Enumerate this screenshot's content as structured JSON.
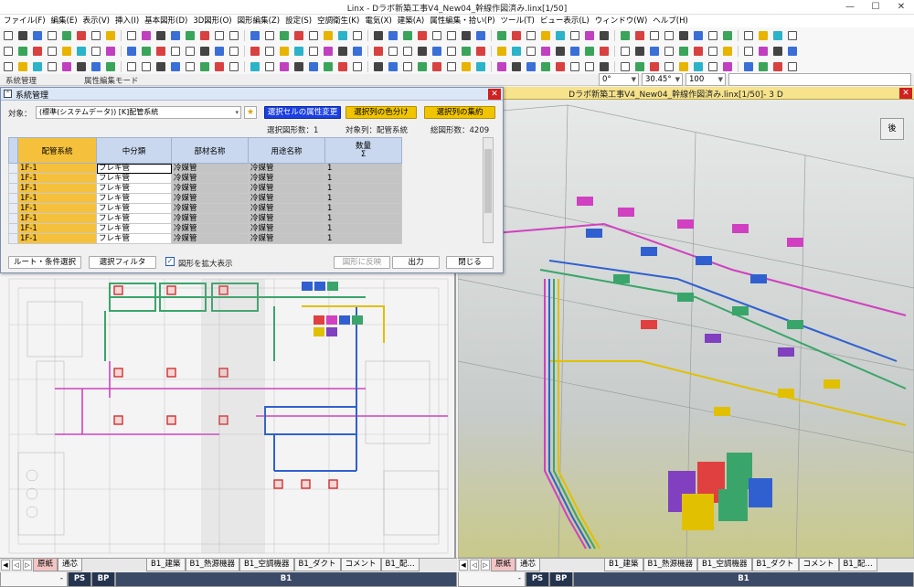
{
  "window": {
    "title": "Linx - Dラボ新築工事V4_New04_幹線作図済み.linx[1/50]",
    "minimize": "—",
    "maximize": "☐",
    "close": "✕"
  },
  "menu": [
    "ファイル(F)",
    "編集(E)",
    "表示(V)",
    "挿入(I)",
    "基本図形(D)",
    "3D図形(O)",
    "図形編集(Z)",
    "設定(S)",
    "空調衛生(K)",
    "電気(X)",
    "建築(A)",
    "属性編集・拾い(P)",
    "ツール(T)",
    "ビュー表示(L)",
    "ウィンドウ(W)",
    "ヘルプ(H)"
  ],
  "status_row": {
    "left_label": "系統管理",
    "right_label": "属性編集モード",
    "angle": "0°",
    "angle2": "30.45°",
    "zoom": "100"
  },
  "dialog": {
    "title": "系統管理",
    "target_label": "対象：",
    "target_value": "(標準(システムデータ)) [K]配管系統",
    "btn_change_attr": "選択セルの属性変更",
    "btn_color_split": "選択列の色分け",
    "btn_aggregate": "選択列の集約",
    "info_selected_shapes": "選択図形数：1",
    "info_target_col": "対象列：配管系統",
    "info_total_shapes": "総図形数：4209",
    "columns": [
      "配管系統",
      "中分類",
      "部材名称",
      "用途名称",
      "数量\nΣ"
    ],
    "rows": [
      [
        "1F-1",
        "フレキ管",
        "冷媒管",
        "冷媒管",
        "1"
      ],
      [
        "1F-1",
        "フレキ管",
        "冷媒管",
        "冷媒管",
        "1"
      ],
      [
        "1F-1",
        "フレキ管",
        "冷媒管",
        "冷媒管",
        "1"
      ],
      [
        "1F-1",
        "フレキ管",
        "冷媒管",
        "冷媒管",
        "1"
      ],
      [
        "1F-1",
        "フレキ管",
        "冷媒管",
        "冷媒管",
        "1"
      ],
      [
        "1F-1",
        "フレキ管",
        "冷媒管",
        "冷媒管",
        "1"
      ],
      [
        "1F-1",
        "フレキ管",
        "冷媒管",
        "冷媒管",
        "1"
      ],
      [
        "1F-1",
        "フレキ管",
        "冷媒管",
        "冷媒管",
        "1"
      ]
    ],
    "btn_route": "ルート・条件選択",
    "btn_filter": "選択フィルタ",
    "chk_enlarge": "図形を拡大表示",
    "btn_reflect": "図形に反映",
    "btn_output": "出力",
    "btn_close": "閉じる"
  },
  "view3d": {
    "title": "Dラボ新築工事V4_New04_幹線作図済み.linx[1/50]- 3 D",
    "cube_label": "後"
  },
  "bottom_left": {
    "tabs_top": [
      "原紙",
      "通芯",
      "B1_建築",
      "B1_熱源機器",
      "B1_空調機器",
      "B1_ダクト",
      "コメント",
      "B1_配..."
    ],
    "tabs_bottom": [
      "-",
      "PS",
      "BP",
      "B1"
    ]
  },
  "bottom_right": {
    "tabs_top": [
      "原紙",
      "通芯",
      "B1_建築",
      "B1_熱源機器",
      "B1_空調機器",
      "B1_ダクト",
      "コメント",
      "B1_配..."
    ],
    "tabs_bottom": [
      "-",
      "PS",
      "BP",
      "B1"
    ]
  },
  "colors": {
    "accent_blue": "#1b3fe0",
    "accent_yellow": "#f0c400",
    "title_3d": "#f6e38c"
  }
}
